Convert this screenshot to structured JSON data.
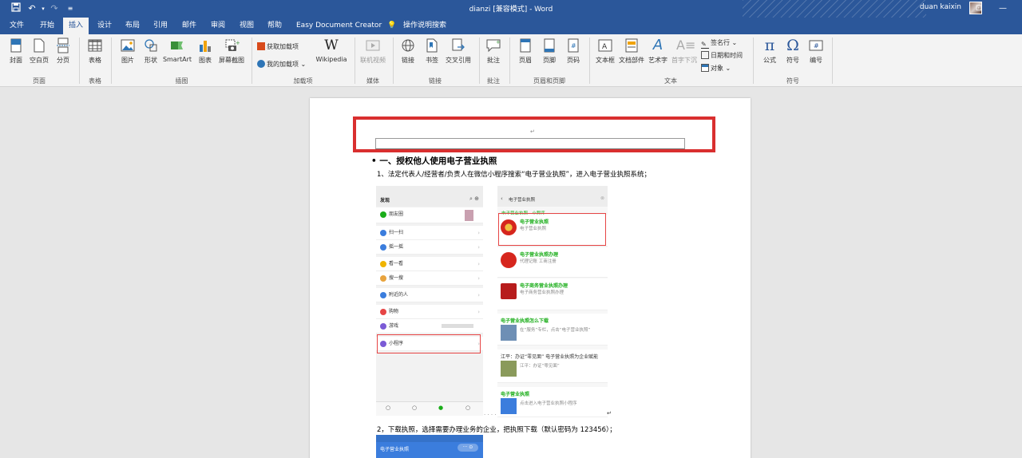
{
  "titlebar": {
    "doc_title": "dianzi  [兼容模式]  -  Word",
    "user": "duan kaixin",
    "icons": [
      "save-icon",
      "undo-icon",
      "redo-icon",
      "customize-icon"
    ]
  },
  "tabs": [
    "文件",
    "开始",
    "插入",
    "设计",
    "布局",
    "引用",
    "邮件",
    "审阅",
    "视图",
    "帮助",
    "Easy Document Creator"
  ],
  "active_tab": "插入",
  "tell_me": "操作说明搜索",
  "ribbon": {
    "pages": {
      "cover": "封面",
      "blank": "空白页",
      "break": "分页",
      "label": "页面"
    },
    "tables": {
      "table": "表格",
      "label": "表格"
    },
    "illustrations": {
      "picture": "图片",
      "shapes": "形状",
      "smartart": "SmartArt",
      "chart": "图表",
      "screenshot": "屏幕截图",
      "label": "插图"
    },
    "addins": {
      "get": "获取加载项",
      "my": "我的加载项",
      "wikipedia": "Wikipedia",
      "label": "加载项"
    },
    "media": {
      "video": "联机视频",
      "label": "媒体"
    },
    "links": {
      "link": "链接",
      "bookmark": "书签",
      "crossref": "交叉引用",
      "label": "链接"
    },
    "comments": {
      "comment": "批注",
      "label": "批注"
    },
    "headerfooter": {
      "header": "页眉",
      "footer": "页脚",
      "pagenum": "页码",
      "label": "页眉和页脚"
    },
    "text": {
      "textbox": "文本框",
      "quickparts": "文档部件",
      "wordart": "艺术字",
      "dropcap": "首字下沉",
      "signature": "签名行",
      "datetime": "日期和时间",
      "object": "对象",
      "label": "文本"
    },
    "symbols": {
      "equation": "公式",
      "symbol": "符号",
      "number": "编号",
      "label": "符号"
    }
  },
  "document": {
    "heading": "• 一、授权他人使用电子营业执照",
    "para1": "1、法定代表人/经营者/负责人在微信小程序搜索“电子营业执照”，进入电子营业执照系统；",
    "para2": "2，下载执照，选择需要办理业务的企业，把执照下载（默认密码为 123456）；",
    "phone1": {
      "title": "发现",
      "items": [
        "朋友圈",
        "扫一扫",
        "摇一摇",
        "看一看",
        "搜一搜",
        "附近的人",
        "购物",
        "游戏",
        "小程序"
      ]
    },
    "phone2": {
      "search": "电子营业执照",
      "section": "电子营业执照 · 小程序",
      "results": [
        {
          "title": "电子营业执照",
          "sub": "电子营业执照"
        },
        {
          "title": "电子营业执照办理",
          "sub": "代理记账 工商注册"
        },
        {
          "title": "电子商务营业执照办理",
          "sub": "电子商务营业执照办理"
        },
        {
          "title": "电子营业执照怎么下载",
          "sub": "在“服务”专栏，点击“电子营业执照”"
        },
        {
          "title": "江平：办证“零见面” 电子营业执照为企业赋能",
          "sub": "江平：办证“零见面”"
        },
        {
          "title": "电子营业执照",
          "sub": "点击进入电子营业执照小程序"
        }
      ]
    },
    "phone3": {
      "title": "电子营业执照"
    }
  }
}
